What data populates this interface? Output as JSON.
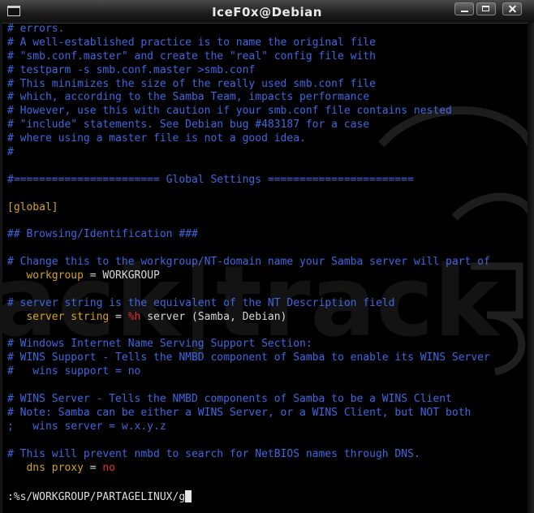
{
  "window": {
    "title": "IceF0x@Debian",
    "icon": "terminal-icon",
    "buttons": [
      "minimize-icon",
      "maximize-icon",
      "close-icon"
    ]
  },
  "colors": {
    "comment": "#3f67e0",
    "section": "#d4a21a",
    "key": "#d4a21a",
    "value": "#dedede",
    "highlight": "#e03030",
    "background": "#000000"
  },
  "lines": [
    [
      {
        "t": "# errors.",
        "c": "comment"
      }
    ],
    [
      {
        "t": "# A well-established practice is to name the original file",
        "c": "comment"
      }
    ],
    [
      {
        "t": "# \"smb.conf.master\" and create the \"real\" config file with",
        "c": "comment"
      }
    ],
    [
      {
        "t": "# testparm -s smb.conf.master >smb.conf",
        "c": "comment"
      }
    ],
    [
      {
        "t": "# This minimizes the size of the really used smb.conf file",
        "c": "comment"
      }
    ],
    [
      {
        "t": "# which, according to the Samba Team, impacts performance",
        "c": "comment"
      }
    ],
    [
      {
        "t": "# However, use this with caution if your smb.conf file contains nested",
        "c": "comment"
      }
    ],
    [
      {
        "t": "# \"include\" statements. See Debian bug #483187 for a case",
        "c": "comment"
      }
    ],
    [
      {
        "t": "# where using a master file is not a good idea.",
        "c": "comment"
      }
    ],
    [
      {
        "t": "#",
        "c": "comment"
      }
    ],
    [],
    [
      {
        "t": "#======================= Global Settings =======================",
        "c": "comment"
      }
    ],
    [],
    [
      {
        "t": "[global]",
        "c": "section"
      }
    ],
    [],
    [
      {
        "t": "## Browsing/Identification ###",
        "c": "comment"
      }
    ],
    [],
    [
      {
        "t": "# Change this to the workgroup/NT-domain name your Samba server will part of",
        "c": "comment"
      }
    ],
    [
      {
        "t": "   workgroup",
        "c": "key"
      },
      {
        "t": " = WORKGROUP",
        "c": "value"
      }
    ],
    [],
    [
      {
        "t": "# server string is the equivalent of the NT Description field",
        "c": "comment"
      }
    ],
    [
      {
        "t": "   server string",
        "c": "key"
      },
      {
        "t": " = ",
        "c": "value"
      },
      {
        "t": "%h",
        "c": "red"
      },
      {
        "t": " server (Samba, Debian)",
        "c": "value"
      }
    ],
    [],
    [
      {
        "t": "# Windows Internet Name Serving Support Section:",
        "c": "comment"
      }
    ],
    [
      {
        "t": "# WINS Support - Tells the NMBD component of Samba to enable its WINS Server",
        "c": "comment"
      }
    ],
    [
      {
        "t": "#   wins support = no",
        "c": "comment"
      }
    ],
    [],
    [
      {
        "t": "# WINS Server - Tells the NMBD components of Samba to be a WINS Client",
        "c": "comment"
      }
    ],
    [
      {
        "t": "# Note: Samba can be either a WINS Server, or a WINS Client, but NOT both",
        "c": "comment"
      }
    ],
    [
      {
        "t": ";   wins server = w.x.y.z",
        "c": "comment"
      }
    ],
    [],
    [
      {
        "t": "# This will prevent nmbd to search for NetBIOS names through DNS.",
        "c": "comment"
      }
    ],
    [
      {
        "t": "   dns proxy",
        "c": "key"
      },
      {
        "t": " = ",
        "c": "value"
      },
      {
        "t": "no",
        "c": "red"
      }
    ]
  ],
  "command": {
    "text": ":%s/WORKGROUP/PARTAGELINUX/g"
  }
}
